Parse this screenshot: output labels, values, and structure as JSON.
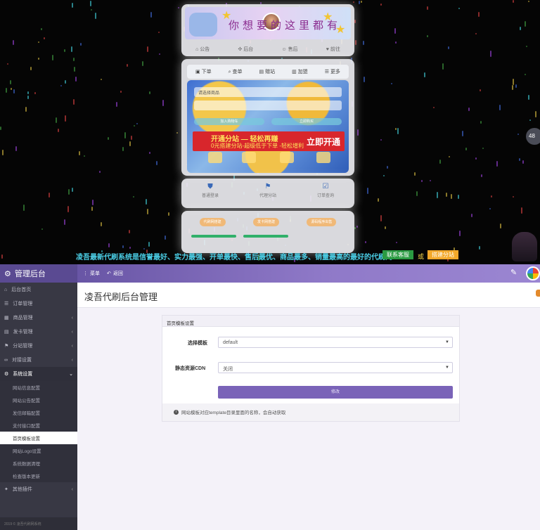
{
  "storefront": {
    "banner_text": "你想要的这里都有",
    "top_nav": [
      "公告",
      "后台",
      "售后",
      "前往"
    ],
    "tool_nav": [
      "下单",
      "查单",
      "赠站",
      "加盟",
      "更多"
    ],
    "overlay_input": "请选择商品",
    "overlay_buttons": [
      "加入购物车",
      "立即购买"
    ],
    "promo_line1": "开通分站 — 轻松再赚",
    "promo_line2": "0元搭建分站-超级低于下单 -轻松增利",
    "promo_cta": "立即开通",
    "stats": [
      "普通登录",
      "代理分站",
      "订单查询"
    ],
    "action_pills": [
      "代刷网搭建",
      "发卡网搭建",
      "源码程序出售"
    ],
    "ticker": "凌吾最新代刷系统是信誉最好、实力最强、开单最快、售后最优、商品最多、销量最高的最好的代刷网",
    "ticker_btn_contact": "联系客服",
    "ticker_or": "或",
    "ticker_btn_build": "搭建分站",
    "side_badge": "48"
  },
  "admin": {
    "brand": "管理后台",
    "header_links": [
      "菜单",
      "返回"
    ],
    "sidebar": {
      "items": [
        {
          "label": "后台首页",
          "icon": "home-icon",
          "chevron": false
        },
        {
          "label": "订单管理",
          "icon": "list-icon",
          "chevron": false
        },
        {
          "label": "商品管理",
          "icon": "box-icon",
          "chevron": true
        },
        {
          "label": "发卡管理",
          "icon": "card-icon",
          "chevron": true
        },
        {
          "label": "分站管理",
          "icon": "sitemap-icon",
          "chevron": true
        },
        {
          "label": "对接设置",
          "icon": "link-icon",
          "chevron": true
        },
        {
          "label": "系统设置",
          "icon": "gear-icon",
          "chevron": true,
          "open": true
        }
      ],
      "sub_items": [
        "网站信息配置",
        "网站公告配置",
        "发信邮箱配置",
        "支付接口配置",
        "首页模板设置",
        "网站Logo设置",
        "系统数据清理",
        "检查版本更新"
      ],
      "active_sub": 4,
      "last_item": {
        "label": "其他插件",
        "icon": "plugin-icon"
      },
      "footer": "2019 © 凌吾代刷网系统"
    },
    "page_title": "凌吾代刷后台管理",
    "panel": {
      "heading": "首页模板设置",
      "template_label": "选择模板",
      "template_value": "default",
      "cdn_label": "静态资源CDN",
      "cdn_value": "关闭",
      "submit_label": "修改",
      "note": "网站模板对应template目录里面的名称，会自动获取"
    }
  },
  "colors": {
    "admin_header": "#8f79c8",
    "sidebar_bg": "#383844",
    "submit_btn": "#7a63b8",
    "promo_red": "#d8262c",
    "ticker_cyan": "#4bd0e8"
  }
}
